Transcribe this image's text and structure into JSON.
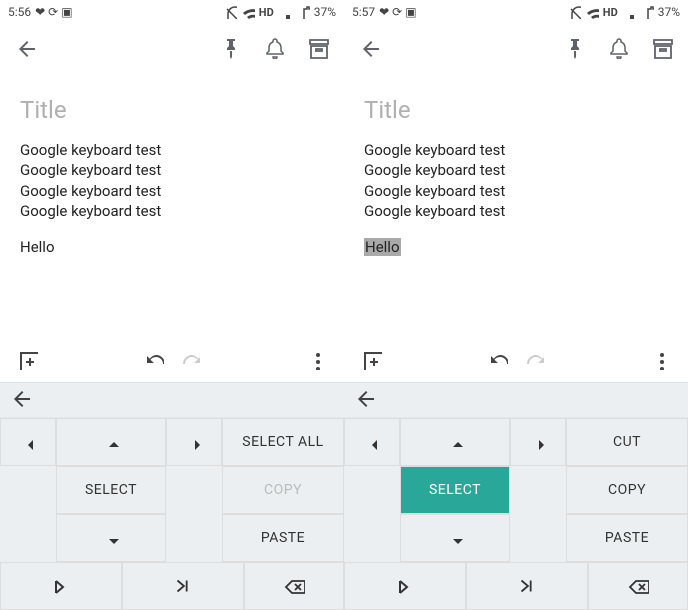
{
  "left": {
    "status": {
      "time": "5:56",
      "hd": "HD",
      "battery": "37%"
    },
    "title_placeholder": "Title",
    "body_lines": [
      "Google keyboard test",
      "Google keyboard test",
      "Google keyboard test",
      "Google keyboard test"
    ],
    "hello": "Hello",
    "kb": {
      "select_all": "SELECT ALL",
      "select": "SELECT",
      "copy": "COPY",
      "paste": "PASTE"
    }
  },
  "right": {
    "status": {
      "time": "5:57",
      "hd": "HD",
      "battery": "37%"
    },
    "title_placeholder": "Title",
    "body_lines": [
      "Google keyboard test",
      "Google keyboard test",
      "Google keyboard test",
      "Google keyboard test"
    ],
    "hello": "Hello",
    "kb": {
      "cut": "CUT",
      "select": "SELECT",
      "copy": "COPY",
      "paste": "PASTE"
    }
  }
}
